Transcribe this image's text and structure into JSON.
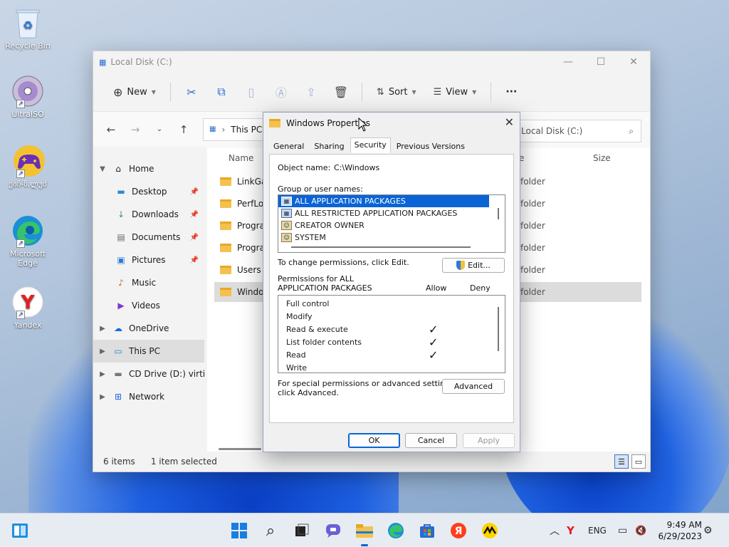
{
  "desktop": {
    "icons": [
      {
        "label": "Recycle Bin",
        "icon": "recycle-bin-icon"
      },
      {
        "label": "UltraISO",
        "icon": "disc-icon"
      },
      {
        "label": "ქიჩ-ზ.ლუძ",
        "icon": "gamepad-icon"
      },
      {
        "label": "Microsoft Edge",
        "icon": "edge-icon"
      },
      {
        "label": "Yandex",
        "icon": "yandex-icon"
      }
    ]
  },
  "explorer": {
    "title": "Local Disk (C:)",
    "toolbar": {
      "new_label": "New",
      "sort_label": "Sort",
      "view_label": "View",
      "more_label": "···"
    },
    "address": {
      "breadcrumb": "This PC",
      "search_placeholder": "ch Local Disk (C:)"
    },
    "columns": {
      "name": "Name",
      "type": "e",
      "size": "Size"
    },
    "sidebar": [
      {
        "label": "Home",
        "level": 0,
        "chevron": "open",
        "icon": "home-icon"
      },
      {
        "label": "Desktop",
        "level": 1,
        "icon": "desktop-icon",
        "pinned": true
      },
      {
        "label": "Downloads",
        "level": 1,
        "icon": "download-icon",
        "pinned": true
      },
      {
        "label": "Documents",
        "level": 1,
        "icon": "documents-icon",
        "pinned": true
      },
      {
        "label": "Pictures",
        "level": 1,
        "icon": "pictures-icon",
        "pinned": true
      },
      {
        "label": "Music",
        "level": 1,
        "icon": "music-icon"
      },
      {
        "label": "Videos",
        "level": 1,
        "icon": "videos-icon"
      },
      {
        "label": "OneDrive",
        "level": 0,
        "chevron": "closed",
        "icon": "cloud-icon"
      },
      {
        "label": "This PC",
        "level": 0,
        "chevron": "closed",
        "icon": "pc-icon",
        "selected": true
      },
      {
        "label": "CD Drive (D:) virtio-w",
        "level": 0,
        "chevron": "closed",
        "icon": "cd-drive-icon"
      },
      {
        "label": "Network",
        "level": 0,
        "chevron": "closed",
        "icon": "network-icon"
      }
    ],
    "files": [
      {
        "name": "LinkGar",
        "type": "folder"
      },
      {
        "name": "PerfLog",
        "type": "folder"
      },
      {
        "name": "Progran",
        "type": "folder"
      },
      {
        "name": "Progran",
        "type": "folder"
      },
      {
        "name": "Users",
        "type": "folder"
      },
      {
        "name": "Window",
        "type": "folder",
        "selected": true
      }
    ],
    "status": {
      "items": "6 items",
      "selected": "1 item selected"
    }
  },
  "dialog": {
    "title": "Windows Properties",
    "tabs": [
      "General",
      "Sharing",
      "Security",
      "Previous Versions"
    ],
    "active_tab": "Security",
    "object_name_label": "Object name:",
    "object_name_value": "C:\\Windows",
    "group_label": "Group or user names:",
    "groups": [
      {
        "name": "ALL APPLICATION PACKAGES",
        "selected": true
      },
      {
        "name": "ALL RESTRICTED APPLICATION PACKAGES"
      },
      {
        "name": "CREATOR OWNER"
      },
      {
        "name": "SYSTEM"
      }
    ],
    "change_text": "To change permissions, click Edit.",
    "edit_label": "Edit...",
    "perms_for_line1": "Permissions for ALL",
    "perms_for_line2": "APPLICATION PACKAGES",
    "allow_label": "Allow",
    "deny_label": "Deny",
    "permissions": [
      {
        "name": "Full control",
        "allow": false
      },
      {
        "name": "Modify",
        "allow": false
      },
      {
        "name": "Read & execute",
        "allow": true
      },
      {
        "name": "List folder contents",
        "allow": true
      },
      {
        "name": "Read",
        "allow": true
      },
      {
        "name": "Write",
        "allow": false
      }
    ],
    "special_line1": "For special permissions or advanced settings,",
    "special_line2": "click Advanced.",
    "advanced_label": "Advanced",
    "ok_label": "OK",
    "cancel_label": "Cancel",
    "apply_label": "Apply"
  },
  "taskbar": {
    "lang": "ENG",
    "time": "9:49 AM",
    "date": "6/29/2023"
  }
}
